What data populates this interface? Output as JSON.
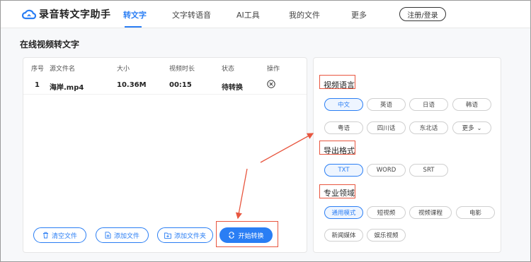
{
  "header": {
    "logo": "录音转文字助手",
    "nav": [
      {
        "label": "转文字",
        "active": true
      },
      {
        "label": "文字转语音",
        "active": false
      },
      {
        "label": "AI工具",
        "active": false
      },
      {
        "label": "我的文件",
        "active": false
      },
      {
        "label": "更多",
        "active": false
      }
    ],
    "login": "注册/登录"
  },
  "page_title": "在线视频转文字",
  "table": {
    "columns": [
      "序号",
      "源文件名",
      "大小",
      "视频时长",
      "状态",
      "操作"
    ],
    "rows": [
      {
        "index": "1",
        "name": "海岸.mp4",
        "size": "10.36M",
        "duration": "00:15",
        "status": "待转换"
      }
    ]
  },
  "actions": {
    "clear": "清空文件",
    "add_file": "添加文件",
    "add_folder": "添加文件夹",
    "start": "开始转换"
  },
  "settings": {
    "language": {
      "title": "视频语言",
      "options": [
        "中文",
        "英语",
        "日语",
        "韩语",
        "粤语",
        "四川话",
        "东北话",
        "更多"
      ],
      "selected": "中文"
    },
    "format": {
      "title": "导出格式",
      "options": [
        "TXT",
        "WORD",
        "SRT"
      ],
      "selected": "TXT"
    },
    "domain": {
      "title": "专业领域",
      "options": [
        "通用模式",
        "短视频",
        "视频课程",
        "电影",
        "新闻媒体",
        "娱乐视频"
      ],
      "selected": "通用模式"
    }
  },
  "colors": {
    "accent": "#2a7ef4",
    "highlight": "#e8563f"
  }
}
